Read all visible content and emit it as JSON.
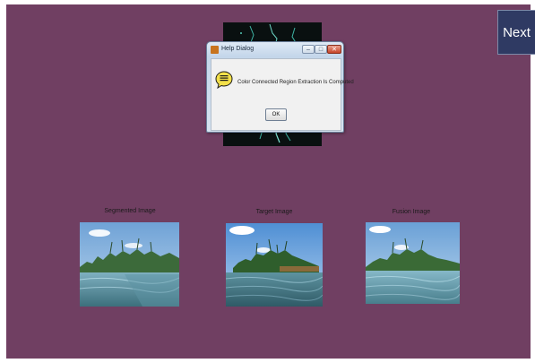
{
  "navigation": {
    "next_label": "Next"
  },
  "panels": [
    {
      "label": "Segmented Image"
    },
    {
      "label": "Target Image"
    },
    {
      "label": "Fusion Image"
    }
  ],
  "help_dialog": {
    "title": "Help Dialog",
    "message": "Color Connected Region Extraction Is Computed",
    "ok_label": "OK",
    "icon": "help-speech-bubble-icon"
  },
  "colors": {
    "figure_background": "#703f62",
    "next_button": "#2f3a63",
    "dialog_frame": "#c4d6ea",
    "dialog_body": "#f1f1f1"
  }
}
